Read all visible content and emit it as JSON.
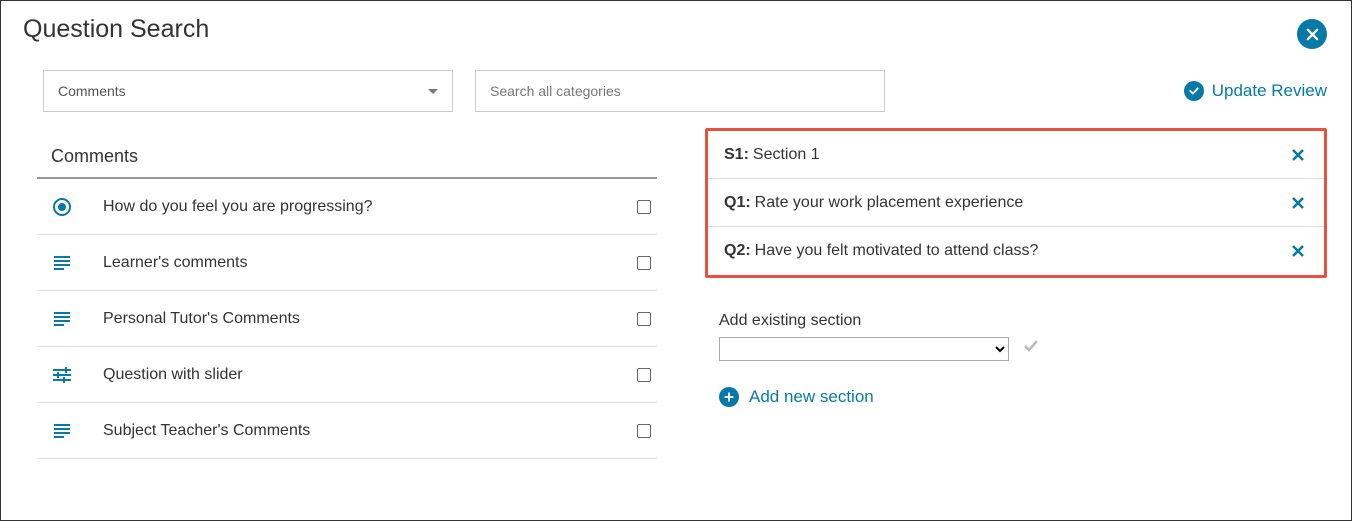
{
  "title": "Question Search",
  "category_dropdown": {
    "selected": "Comments"
  },
  "search": {
    "placeholder": "Search all categories"
  },
  "update_review": "Update Review",
  "left": {
    "heading": "Comments",
    "questions": [
      {
        "icon": "radio",
        "label": "How do you feel you are progressing?"
      },
      {
        "icon": "text",
        "label": "Learner's comments"
      },
      {
        "icon": "text",
        "label": "Personal Tutor's Comments"
      },
      {
        "icon": "slider",
        "label": "Question with slider"
      },
      {
        "icon": "text",
        "label": "Subject Teacher's Comments"
      }
    ]
  },
  "selected": [
    {
      "prefix": "S1:",
      "label": "Section 1"
    },
    {
      "prefix": "Q1:",
      "label": "Rate your work placement experience"
    },
    {
      "prefix": "Q2:",
      "label": "Have you felt motivated to attend class?"
    }
  ],
  "add_existing": {
    "label": "Add existing section"
  },
  "add_new": "Add new section"
}
